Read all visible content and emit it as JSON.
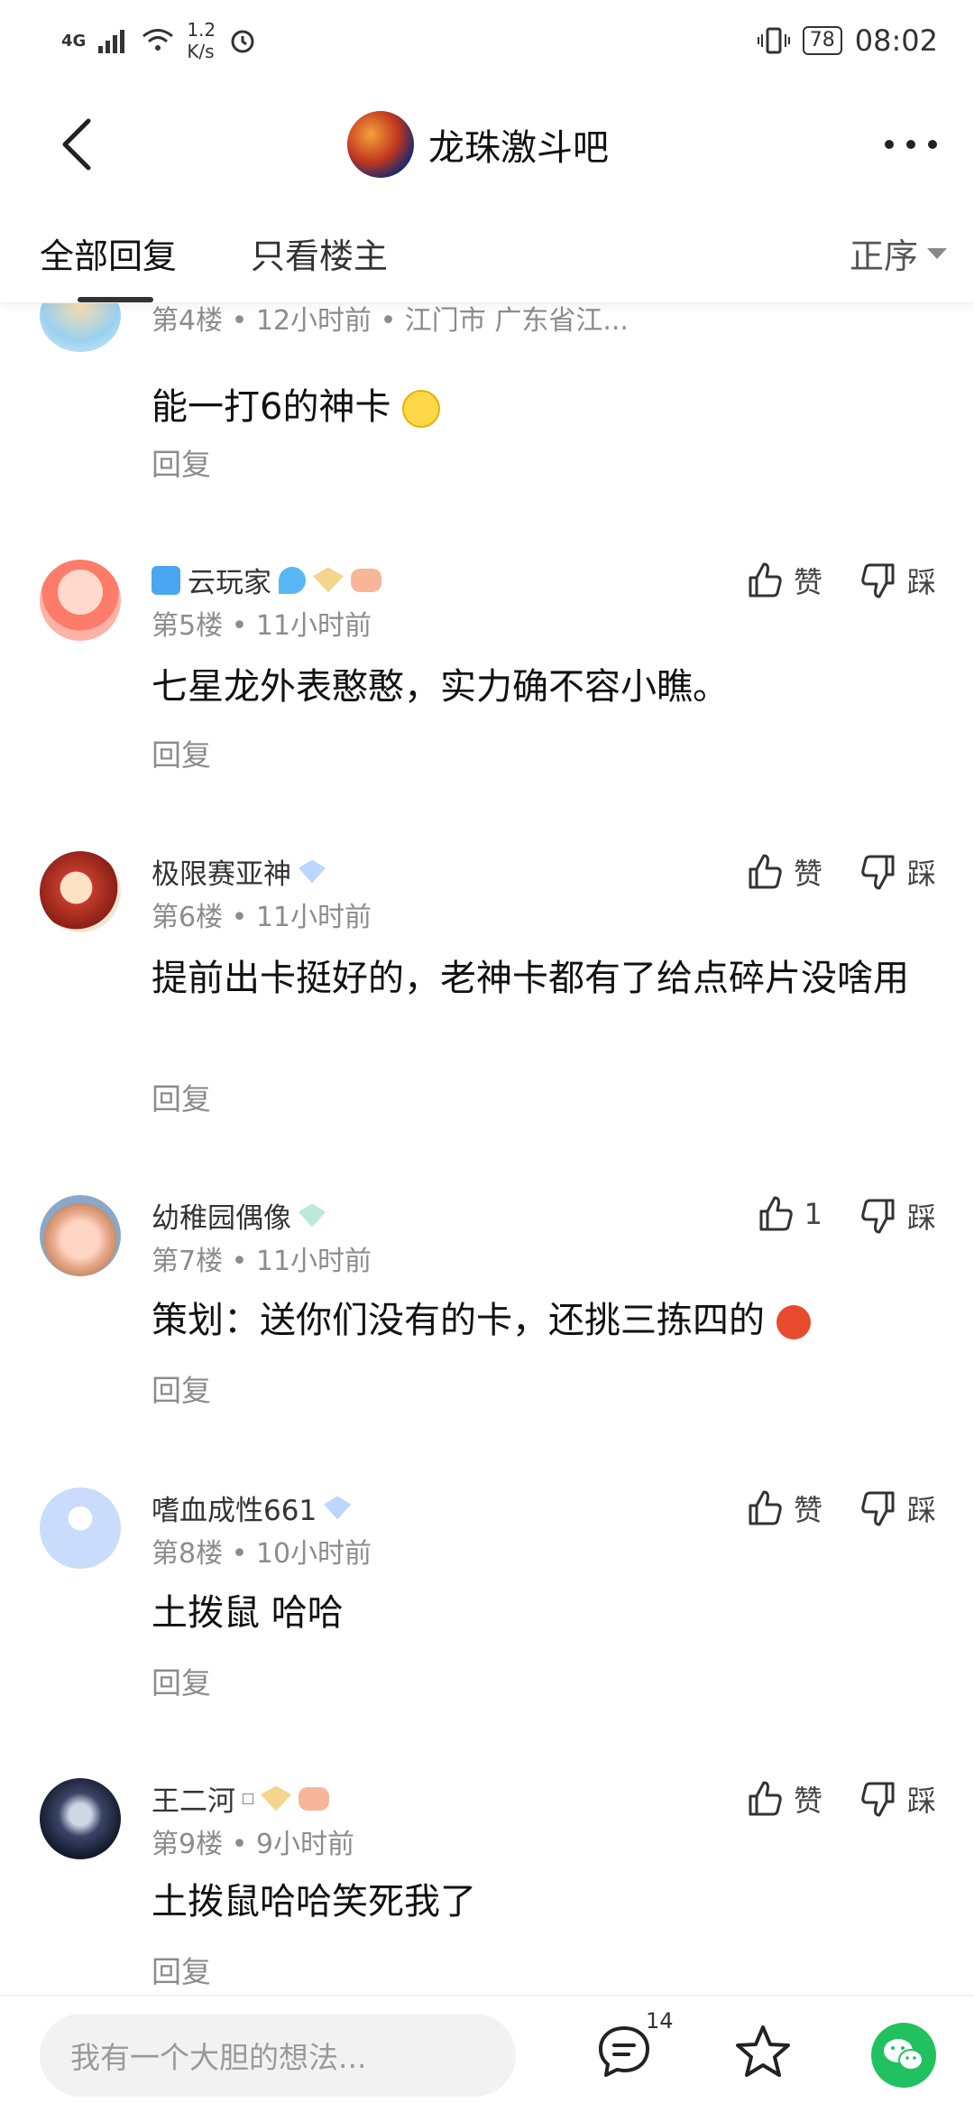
{
  "status_bar": {
    "network": "4G",
    "speed_value": "1.2",
    "speed_unit": "K/s",
    "battery": "78",
    "time": "08:02"
  },
  "header": {
    "title": "龙珠激斗吧"
  },
  "tabs": {
    "all": "全部回复",
    "owner_only": "只看楼主",
    "sort": "正序"
  },
  "posts": [
    {
      "floor_meta": "第4楼 • 12小时前 • 江门市 广东省江...",
      "content": "能一打6的神卡",
      "reply": "回复"
    },
    {
      "username": "云玩家",
      "floor_meta": "第5楼 • 11小时前",
      "content": "七星龙外表憨憨，实力确不容小瞧。",
      "reply": "回复",
      "like": "赞",
      "dislike": "踩",
      "level": "10"
    },
    {
      "username": "极限赛亚神",
      "floor_meta": "第6楼 • 11小时前",
      "content": "提前出卡挺好的，老神卡都有了给点碎片没啥用",
      "reply": "回复",
      "like": "赞",
      "dislike": "踩",
      "level": "8"
    },
    {
      "username": "幼稚园偶像",
      "floor_meta": "第7楼 • 11小时前",
      "content": "策划：送你们没有的卡，还挑三拣四的",
      "reply": "回复",
      "like": "1",
      "dislike": "踩",
      "level": "1"
    },
    {
      "username": "嗜血成性661",
      "floor_meta": "第8楼 • 10小时前",
      "content": "土拨鼠 哈哈",
      "reply": "回复",
      "like": "赞",
      "dislike": "踩",
      "level": "8"
    },
    {
      "username": "王二河",
      "floor_meta": "第9楼 • 9小时前",
      "content": "土拨鼠哈哈笑死我了",
      "reply": "回复",
      "like": "赞",
      "dislike": "踩",
      "level": "10"
    }
  ],
  "bottom_bar": {
    "placeholder": "我有一个大胆的想法...",
    "comment_count": "14"
  }
}
